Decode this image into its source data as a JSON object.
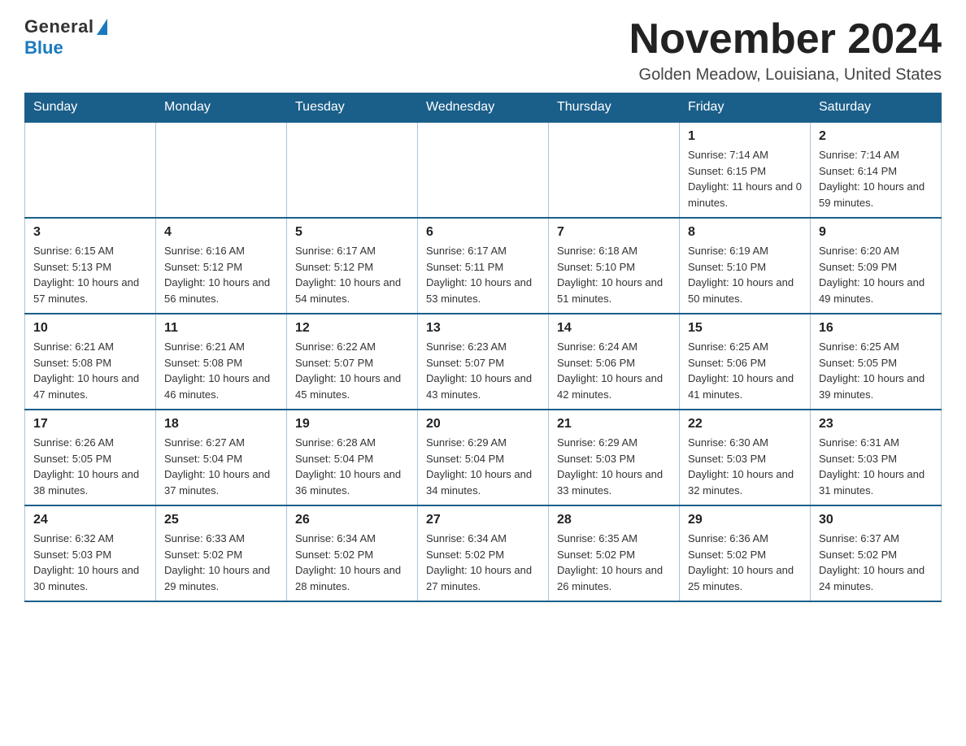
{
  "logo": {
    "general": "General",
    "blue": "Blue"
  },
  "header": {
    "month": "November 2024",
    "location": "Golden Meadow, Louisiana, United States"
  },
  "days_of_week": [
    "Sunday",
    "Monday",
    "Tuesday",
    "Wednesday",
    "Thursday",
    "Friday",
    "Saturday"
  ],
  "weeks": [
    [
      {
        "day": "",
        "info": ""
      },
      {
        "day": "",
        "info": ""
      },
      {
        "day": "",
        "info": ""
      },
      {
        "day": "",
        "info": ""
      },
      {
        "day": "",
        "info": ""
      },
      {
        "day": "1",
        "info": "Sunrise: 7:14 AM\nSunset: 6:15 PM\nDaylight: 11 hours and 0 minutes."
      },
      {
        "day": "2",
        "info": "Sunrise: 7:14 AM\nSunset: 6:14 PM\nDaylight: 10 hours and 59 minutes."
      }
    ],
    [
      {
        "day": "3",
        "info": "Sunrise: 6:15 AM\nSunset: 5:13 PM\nDaylight: 10 hours and 57 minutes."
      },
      {
        "day": "4",
        "info": "Sunrise: 6:16 AM\nSunset: 5:12 PM\nDaylight: 10 hours and 56 minutes."
      },
      {
        "day": "5",
        "info": "Sunrise: 6:17 AM\nSunset: 5:12 PM\nDaylight: 10 hours and 54 minutes."
      },
      {
        "day": "6",
        "info": "Sunrise: 6:17 AM\nSunset: 5:11 PM\nDaylight: 10 hours and 53 minutes."
      },
      {
        "day": "7",
        "info": "Sunrise: 6:18 AM\nSunset: 5:10 PM\nDaylight: 10 hours and 51 minutes."
      },
      {
        "day": "8",
        "info": "Sunrise: 6:19 AM\nSunset: 5:10 PM\nDaylight: 10 hours and 50 minutes."
      },
      {
        "day": "9",
        "info": "Sunrise: 6:20 AM\nSunset: 5:09 PM\nDaylight: 10 hours and 49 minutes."
      }
    ],
    [
      {
        "day": "10",
        "info": "Sunrise: 6:21 AM\nSunset: 5:08 PM\nDaylight: 10 hours and 47 minutes."
      },
      {
        "day": "11",
        "info": "Sunrise: 6:21 AM\nSunset: 5:08 PM\nDaylight: 10 hours and 46 minutes."
      },
      {
        "day": "12",
        "info": "Sunrise: 6:22 AM\nSunset: 5:07 PM\nDaylight: 10 hours and 45 minutes."
      },
      {
        "day": "13",
        "info": "Sunrise: 6:23 AM\nSunset: 5:07 PM\nDaylight: 10 hours and 43 minutes."
      },
      {
        "day": "14",
        "info": "Sunrise: 6:24 AM\nSunset: 5:06 PM\nDaylight: 10 hours and 42 minutes."
      },
      {
        "day": "15",
        "info": "Sunrise: 6:25 AM\nSunset: 5:06 PM\nDaylight: 10 hours and 41 minutes."
      },
      {
        "day": "16",
        "info": "Sunrise: 6:25 AM\nSunset: 5:05 PM\nDaylight: 10 hours and 39 minutes."
      }
    ],
    [
      {
        "day": "17",
        "info": "Sunrise: 6:26 AM\nSunset: 5:05 PM\nDaylight: 10 hours and 38 minutes."
      },
      {
        "day": "18",
        "info": "Sunrise: 6:27 AM\nSunset: 5:04 PM\nDaylight: 10 hours and 37 minutes."
      },
      {
        "day": "19",
        "info": "Sunrise: 6:28 AM\nSunset: 5:04 PM\nDaylight: 10 hours and 36 minutes."
      },
      {
        "day": "20",
        "info": "Sunrise: 6:29 AM\nSunset: 5:04 PM\nDaylight: 10 hours and 34 minutes."
      },
      {
        "day": "21",
        "info": "Sunrise: 6:29 AM\nSunset: 5:03 PM\nDaylight: 10 hours and 33 minutes."
      },
      {
        "day": "22",
        "info": "Sunrise: 6:30 AM\nSunset: 5:03 PM\nDaylight: 10 hours and 32 minutes."
      },
      {
        "day": "23",
        "info": "Sunrise: 6:31 AM\nSunset: 5:03 PM\nDaylight: 10 hours and 31 minutes."
      }
    ],
    [
      {
        "day": "24",
        "info": "Sunrise: 6:32 AM\nSunset: 5:03 PM\nDaylight: 10 hours and 30 minutes."
      },
      {
        "day": "25",
        "info": "Sunrise: 6:33 AM\nSunset: 5:02 PM\nDaylight: 10 hours and 29 minutes."
      },
      {
        "day": "26",
        "info": "Sunrise: 6:34 AM\nSunset: 5:02 PM\nDaylight: 10 hours and 28 minutes."
      },
      {
        "day": "27",
        "info": "Sunrise: 6:34 AM\nSunset: 5:02 PM\nDaylight: 10 hours and 27 minutes."
      },
      {
        "day": "28",
        "info": "Sunrise: 6:35 AM\nSunset: 5:02 PM\nDaylight: 10 hours and 26 minutes."
      },
      {
        "day": "29",
        "info": "Sunrise: 6:36 AM\nSunset: 5:02 PM\nDaylight: 10 hours and 25 minutes."
      },
      {
        "day": "30",
        "info": "Sunrise: 6:37 AM\nSunset: 5:02 PM\nDaylight: 10 hours and 24 minutes."
      }
    ]
  ]
}
